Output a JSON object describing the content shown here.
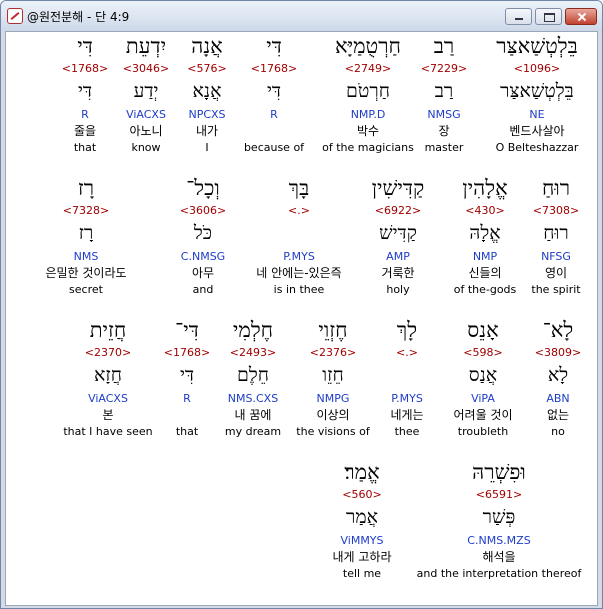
{
  "window": {
    "title": "@원전분해 - 단 4:9"
  },
  "rows": [
    [
      {
        "heb": "בֵּלְטְשַׁאצַּר",
        "num": "<1096>",
        "heb2": "בֵּלְטְשַׁאצַּר",
        "pars": "NE",
        "kor": "벤드사살아",
        "eng": "O Belteshazzar"
      },
      {
        "heb": "רַב",
        "num": "<7229>",
        "heb2": "רַב",
        "pars": "NMSG",
        "kor": "장",
        "eng": "master"
      },
      {
        "heb": "חַרְטֻמַיָּא",
        "num": "<2749>",
        "heb2": "חַרְטֹם",
        "pars": "NMP.D",
        "kor": "박수",
        "eng": "of the magicians"
      },
      {
        "heb": "דִּי",
        "num": "<1768>",
        "heb2": "דִּי",
        "pars": "R",
        "kor": "",
        "eng": "because of"
      },
      {
        "heb": "אֲנָה",
        "num": "<576>",
        "heb2": "אֲנָא",
        "pars": "NPCXS",
        "kor": "내가",
        "eng": "I"
      },
      {
        "heb": "יִדְעֵת",
        "num": "<3046>",
        "heb2": "יְדַע",
        "pars": "ViACXS",
        "kor": "아노니",
        "eng": "know"
      },
      {
        "heb": "דִּי",
        "num": "<1768>",
        "heb2": "דִּי",
        "pars": "R",
        "kor": "줄을",
        "eng": "that"
      }
    ],
    [
      {
        "heb": "רוּחַ",
        "num": "<7308>",
        "heb2": "רוּחַ",
        "pars": "NFSG",
        "kor": "영이",
        "eng": "the spirit"
      },
      {
        "heb": "אֱלָהִין",
        "num": "<430>",
        "heb2": "אֱלָהּ",
        "pars": "NMP",
        "kor": "신들의",
        "eng": "of the-gods"
      },
      {
        "heb": "קַדִּישִׁין",
        "num": "<6922>",
        "heb2": "קַדִּישׁ",
        "pars": "AMP",
        "kor": "거룩한",
        "eng": "holy"
      },
      {
        "heb": "בָּךְ",
        "num": "<.>",
        "heb2": "",
        "pars": "P.MYS",
        "kor": "네 안에는-있은즉",
        "eng": "is in thee"
      },
      {
        "heb": "וְכָל־",
        "num": "<3606>",
        "heb2": "כֹּל",
        "pars": "C.NMSG",
        "kor": "아무",
        "eng": "and"
      },
      {
        "heb": "רָז",
        "num": "<7328>",
        "heb2": "רָז",
        "pars": "NMS",
        "kor": "은밀한 것이라도",
        "eng": "secret"
      }
    ],
    [
      {
        "heb": "לָא־",
        "num": "<3809>",
        "heb2": "לָא",
        "pars": "ABN",
        "kor": "없는",
        "eng": "no"
      },
      {
        "heb": "אָנֵס",
        "num": "<598>",
        "heb2": "אֲנַס",
        "pars": "ViPA",
        "kor": "어려울 것이",
        "eng": "troubleth"
      },
      {
        "heb": "לָךְ",
        "num": "<.>",
        "heb2": "",
        "pars": "P.MYS",
        "kor": "네게는",
        "eng": "thee"
      },
      {
        "heb": "חֶזְוֵי",
        "num": "<2376>",
        "heb2": "חֵזֵו",
        "pars": "NMPG",
        "kor": "이상의",
        "eng": "the visions of"
      },
      {
        "heb": "חֶלְמִי",
        "num": "<2493>",
        "heb2": "חֵלֶם",
        "pars": "NMS.CXS",
        "kor": "내 꿈에",
        "eng": "my dream"
      },
      {
        "heb": "דִּי־",
        "num": "<1768>",
        "heb2": "דִּי",
        "pars": "R",
        "kor": "",
        "eng": "that"
      },
      {
        "heb": "חֲזֵית",
        "num": "<2370>",
        "heb2": "חֲזָא",
        "pars": "ViACXS",
        "kor": "본",
        "eng": "that I have seen"
      }
    ],
    [
      {
        "heb": "וּפִשְׁרֵהּ",
        "num": "<6591>",
        "heb2": "פְּשַׁר",
        "pars": "C.NMS.MZS",
        "kor": "해석을",
        "eng": "and the interpretation thereof"
      },
      {
        "heb": "אֱמַר׃",
        "num": "<560>",
        "heb2": "אֲמַר",
        "pars": "ViMMYS",
        "kor": "내게 고하라",
        "eng": "tell me"
      }
    ]
  ]
}
